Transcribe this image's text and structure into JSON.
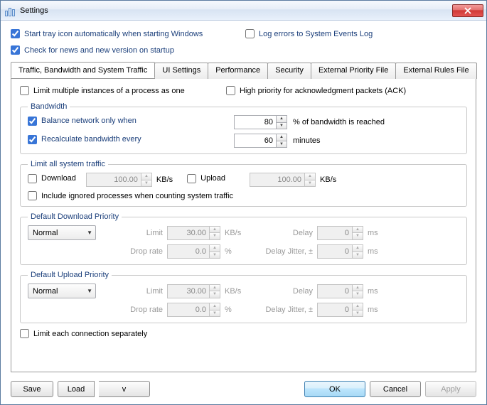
{
  "window": {
    "title": "Settings"
  },
  "top_checks": {
    "start_tray": {
      "label": "Start tray icon automatically when starting Windows",
      "checked": true
    },
    "log_errors": {
      "label": "Log errors to System Events Log",
      "checked": false
    },
    "check_news": {
      "label": "Check for news and new version on startup",
      "checked": true
    }
  },
  "tabs": {
    "t0": "Traffic, Bandwidth and System Traffic",
    "t1": "UI Settings",
    "t2": "Performance",
    "t3": "Security",
    "t4": "External Priority File",
    "t5": "External Rules File"
  },
  "panel": {
    "limit_multiple": "Limit multiple instances of a process as one",
    "high_priority_ack": "High priority for acknowledgment packets (ACK)",
    "bandwidth": {
      "legend": "Bandwidth",
      "balance_label": "Balance network only when",
      "balance_value": "80",
      "balance_suffix": "% of bandwidth is reached",
      "recalc_label": "Recalculate bandwidth every",
      "recalc_value": "60",
      "recalc_suffix": "minutes"
    },
    "system_traffic": {
      "legend": "Limit all system traffic",
      "download": "Download",
      "download_value": "100.00",
      "upload": "Upload",
      "upload_value": "100.00",
      "kbs": "KB/s",
      "include_ignored": "Include ignored processes when counting system traffic"
    },
    "download_priority": {
      "legend": "Default Download Priority",
      "value": "Normal",
      "limit_label": "Limit",
      "limit_value": "30.00",
      "limit_unit": "KB/s",
      "delay_label": "Delay",
      "delay_value": "0",
      "ms": "ms",
      "drop_label": "Drop rate",
      "drop_value": "0.0",
      "pct": "%",
      "jitter_label": "Delay Jitter, ±",
      "jitter_value": "0"
    },
    "upload_priority": {
      "legend": "Default Upload Priority",
      "value": "Normal",
      "limit_label": "Limit",
      "limit_value": "30.00",
      "limit_unit": "KB/s",
      "delay_label": "Delay",
      "delay_value": "0",
      "ms": "ms",
      "drop_label": "Drop rate",
      "drop_value": "0.0",
      "pct": "%",
      "jitter_label": "Delay Jitter, ±",
      "jitter_value": "0"
    },
    "limit_each_conn": "Limit each connection separately"
  },
  "footer": {
    "save": "Save",
    "load": "Load",
    "load_arrow": "v",
    "ok": "OK",
    "cancel": "Cancel",
    "apply": "Apply"
  }
}
